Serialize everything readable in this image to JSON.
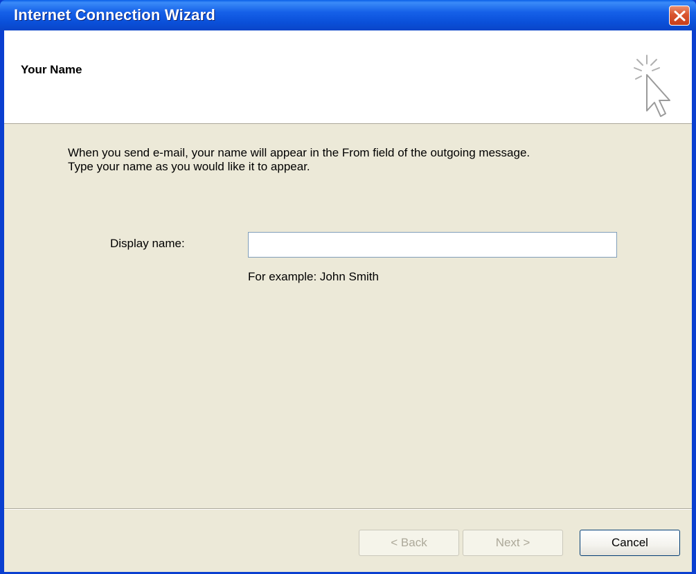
{
  "window": {
    "title": "Internet Connection Wizard"
  },
  "header": {
    "title": "Your Name",
    "icon": "wizard-cursor-sparkle-icon"
  },
  "intro": {
    "line1": "When you send e-mail, your name will appear in the From field of the outgoing message.",
    "line2": "Type your name as you would like it to appear."
  },
  "form": {
    "display_name_label": "Display name:",
    "display_name_value": "",
    "example": "For example: John Smith"
  },
  "buttons": {
    "back": "< Back",
    "next": "Next >",
    "cancel": "Cancel",
    "back_enabled": false,
    "next_enabled": false,
    "cancel_enabled": true
  },
  "colors": {
    "titlebar": "#0A4FD8",
    "dialog_bg": "#ECE9D8",
    "close_button": "#D9542E"
  }
}
